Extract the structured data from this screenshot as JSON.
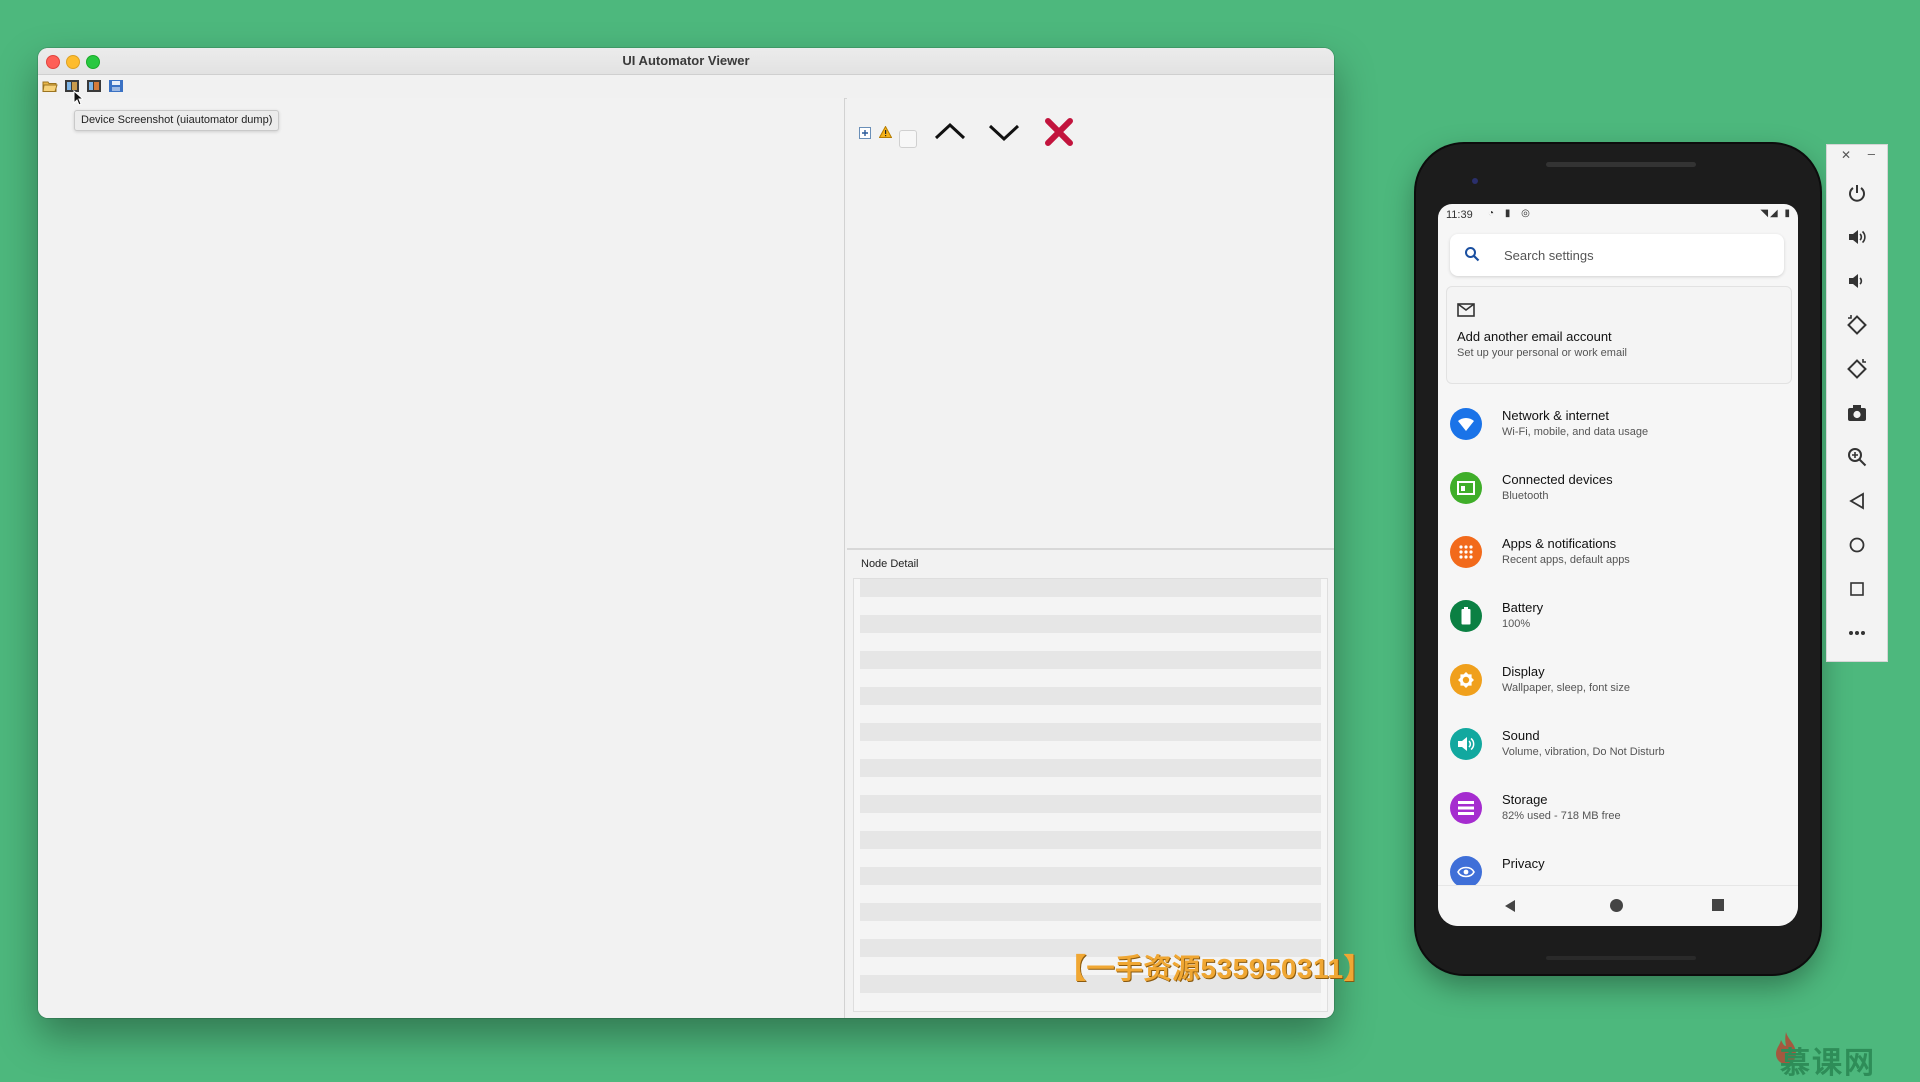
{
  "window": {
    "title": "UI Automator Viewer"
  },
  "toolbar": {
    "tooltip": "Device Screenshot (uiautomator dump)"
  },
  "right_pane": {
    "node_detail_label": "Node Detail",
    "colors": {
      "close_x": "#c2143d"
    }
  },
  "watermark": {
    "text": "【一手资源535950311】"
  },
  "phone": {
    "status_bar": {
      "time": "11:39"
    },
    "search": {
      "placeholder": "Search settings"
    },
    "account_card": {
      "title": "Add another email account",
      "subtitle": "Set up your personal or work email"
    },
    "settings": [
      {
        "title": "Network & internet",
        "subtitle": "Wi-Fi, mobile, and data usage",
        "icon": "wifi-icon",
        "color": "#1a73e8"
      },
      {
        "title": "Connected devices",
        "subtitle": "Bluetooth",
        "icon": "connected-devices-icon",
        "color": "#3fae29"
      },
      {
        "title": "Apps & notifications",
        "subtitle": "Recent apps, default apps",
        "icon": "apps-grid-icon",
        "color": "#f26a1b"
      },
      {
        "title": "Battery",
        "subtitle": "100%",
        "icon": "battery-icon",
        "color": "#0b8043"
      },
      {
        "title": "Display",
        "subtitle": "Wallpaper, sleep, font size",
        "icon": "brightness-icon",
        "color": "#f0a01c"
      },
      {
        "title": "Sound",
        "subtitle": "Volume, vibration, Do Not Disturb",
        "icon": "volume-icon",
        "color": "#12a89f"
      },
      {
        "title": "Storage",
        "subtitle": "82% used - 718 MB free",
        "icon": "storage-icon",
        "color": "#a52ccf"
      },
      {
        "title": "Privacy",
        "subtitle": "",
        "icon": "privacy-eye-icon",
        "color": "#3f6fd8"
      }
    ]
  },
  "emulator_panel": {
    "buttons": [
      "power-icon",
      "volume-up-icon",
      "volume-down-icon",
      "rotate-left-icon",
      "rotate-right-icon",
      "camera-icon",
      "zoom-icon",
      "back-icon",
      "home-icon",
      "overview-icon",
      "more-icon"
    ]
  },
  "brand": {
    "logo_text": "慕课网"
  }
}
